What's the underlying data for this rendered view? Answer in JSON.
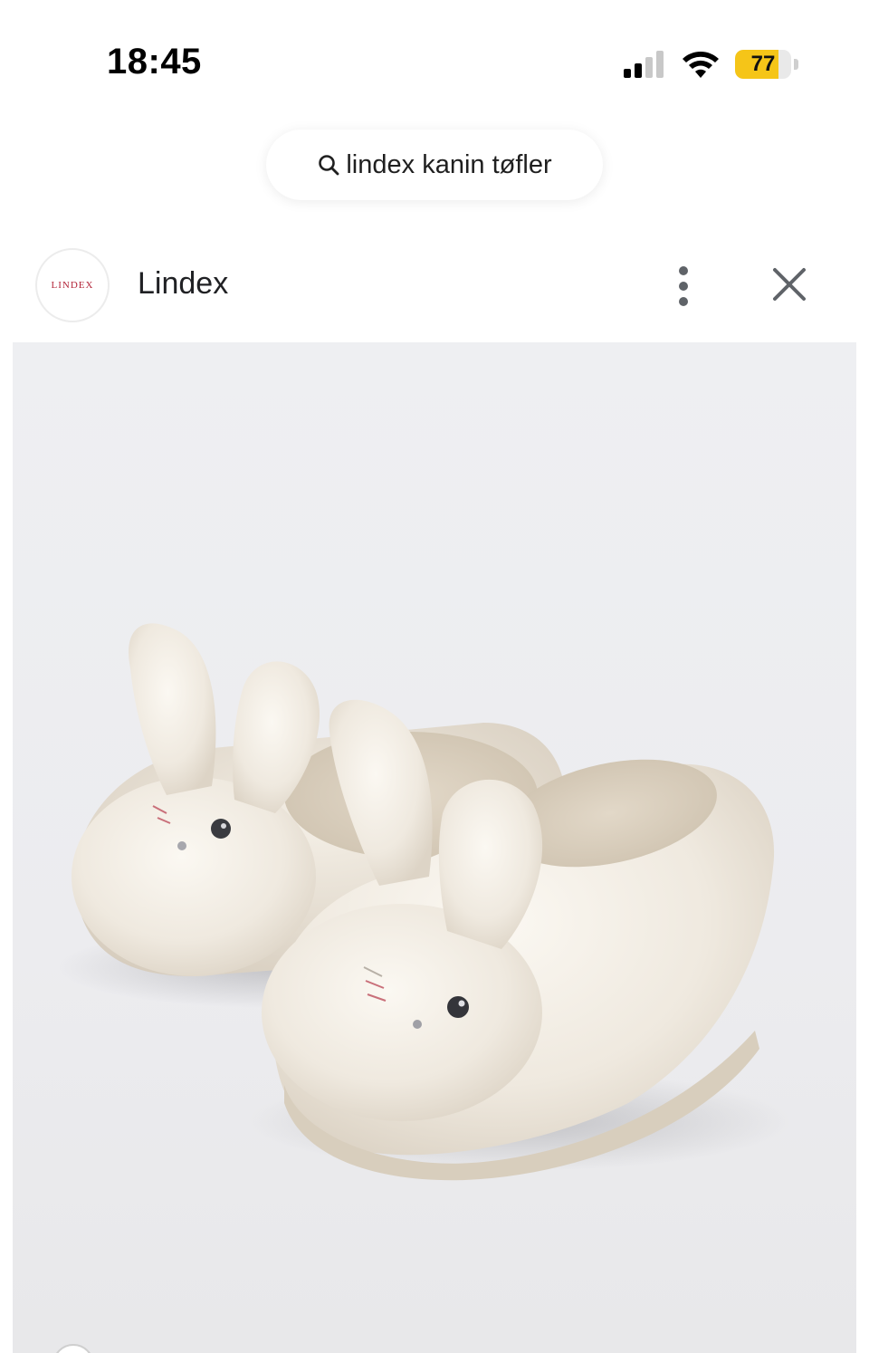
{
  "status_bar": {
    "time": "18:45",
    "battery_level": "77",
    "battery_fraction": 0.77,
    "signal_bars_active": 2,
    "signal_bars_total": 4,
    "icons": [
      "signal-icon",
      "wifi-icon",
      "battery-icon"
    ],
    "battery_color": "#f5c518"
  },
  "search": {
    "query": "lindex kanin tøfler",
    "icon": "search-icon"
  },
  "source": {
    "logo_text": "LINDEX",
    "name": "Lindex",
    "brand_color": "#b3263a",
    "icons": [
      "more-vert-icon",
      "close-icon"
    ]
  },
  "product_image": {
    "subject": "bunny-slippers-image"
  }
}
